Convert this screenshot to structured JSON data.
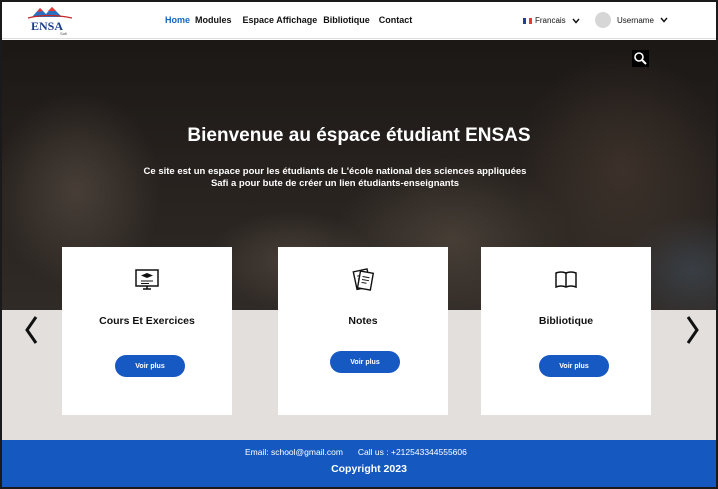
{
  "logo": {
    "name": "ENSA",
    "sub": "Safi"
  },
  "nav": {
    "items": [
      "Home",
      "Modules",
      "Espace Affichage",
      "Bibliotique",
      "Contact"
    ],
    "active": "Home"
  },
  "lang": {
    "label": "Francais"
  },
  "user": {
    "name": "Username"
  },
  "hero": {
    "title": "Bienvenue au éspace étudiant ENSAS",
    "subtitle": "Ce site est un espace pour les étudiants de L'école national des sciences appliquées\nSafi a pour bute  de créer un lien étudiants-enseignants"
  },
  "cards": [
    {
      "title": "Cours Et Exercices",
      "button": "Voir plus",
      "icon": "computer-lesson-icon"
    },
    {
      "title": "Notes",
      "button": "Voir plus",
      "icon": "notes-icon"
    },
    {
      "title": "Bibliotique",
      "button": "Voir plus",
      "icon": "book-icon"
    }
  ],
  "footer": {
    "email": "Email: school@gmail.com",
    "phone": "Call us : +212543344555606",
    "copyright": "Copyright 2023"
  },
  "colors": {
    "accent": "#1559c0",
    "button": "#1759c2"
  }
}
